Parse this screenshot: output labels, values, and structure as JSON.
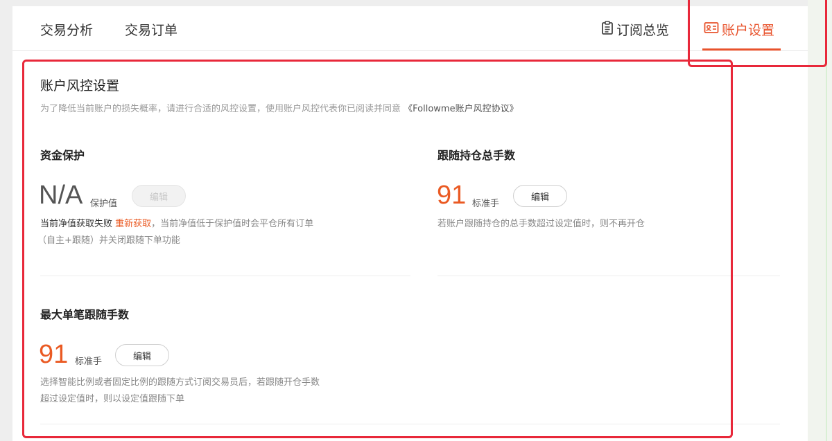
{
  "nav": {
    "tabs": [
      {
        "label": "交易分析"
      },
      {
        "label": "交易订单"
      },
      {
        "label": "订阅总览",
        "icon": "clipboard-icon"
      },
      {
        "label": "账户设置",
        "icon": "account-card-icon",
        "active": true
      }
    ]
  },
  "risk": {
    "title": "账户风控设置",
    "description": "为了降低当前账户的损失概率，请进行合适的风控设置，使用账户风控代表你已阅读并同意",
    "agreement": "《Followme账户风控协议》"
  },
  "fund_protection": {
    "title": "资金保护",
    "value": "N/A",
    "unit": "保护值",
    "edit_label": "编辑",
    "status_text": "当前净值获取失败",
    "retry_label": "重新获取",
    "note_rest": "，当前净值低于保护值时会平仓所有订单",
    "note_line2": "（自主+跟随）并关闭跟随下单功能"
  },
  "total_lots": {
    "title": "跟随持仓总手数",
    "value": "91",
    "unit": "标准手",
    "edit_label": "编辑",
    "note": "若账户跟随持仓的总手数超过设定值时，则不再开仓"
  },
  "max_single": {
    "title": "最大单笔跟随手数",
    "value": "91",
    "unit": "标准手",
    "edit_label": "编辑",
    "note_line1": "选择智能比例或者固定比例的跟随方式订阅交易员后，若跟随开仓手数",
    "note_line2": "超过设定值时，则以设定值跟随下单"
  },
  "colors": {
    "accent": "#e8532c",
    "highlight_border": "#e8283a"
  }
}
